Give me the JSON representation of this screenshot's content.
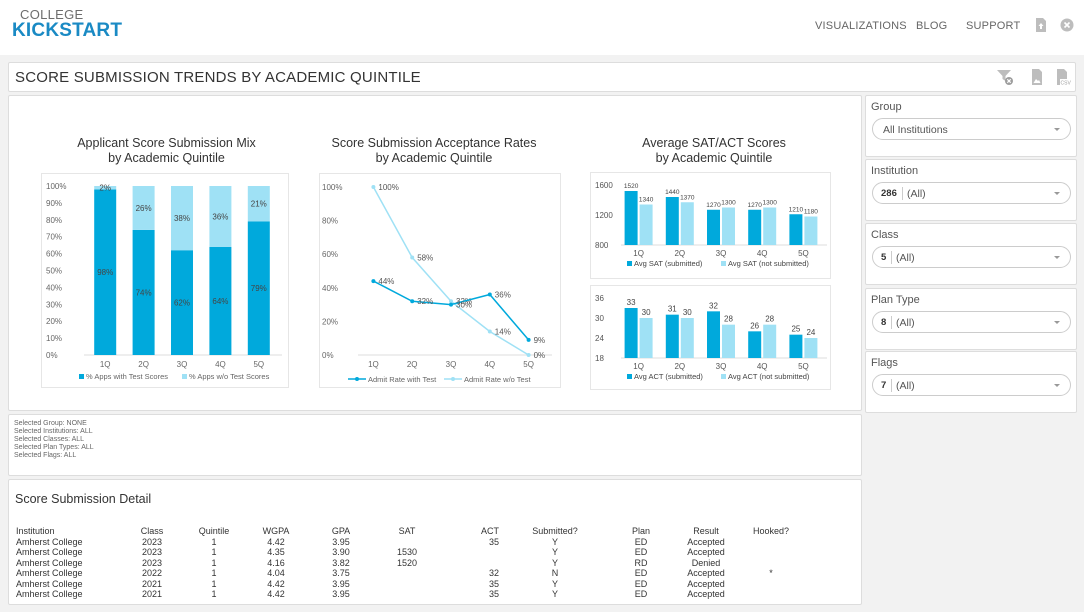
{
  "header": {
    "logo_top": "COLLEGE",
    "logo_bottom": "KICKSTART",
    "nav": [
      "VISUALIZATIONS",
      "BLOG",
      "SUPPORT"
    ],
    "icons": [
      "upload-file-icon",
      "close-circle-icon"
    ]
  },
  "page": {
    "title": "SCORE SUBMISSION TRENDS BY ACADEMIC QUINTILE",
    "toolbar_icons": [
      "clear-filter-icon",
      "image-export-icon",
      "csv-export-icon"
    ]
  },
  "colors": {
    "primary": "#00a9dc",
    "secondary": "#9fe1f5",
    "axis_text": "#666666"
  },
  "chart_data": [
    {
      "type": "bar",
      "stacked": true,
      "title": "Applicant Score Submission Mix\nby Academic Quintile",
      "title_lines": [
        "Applicant Score Submission Mix",
        "by Academic Quintile"
      ],
      "categories": [
        "1Q",
        "2Q",
        "3Q",
        "4Q",
        "5Q"
      ],
      "series": [
        {
          "name": "% Apps with Test Scores",
          "values": [
            98,
            74,
            62,
            64,
            79
          ]
        },
        {
          "name": "% Apps w/o Test Scores",
          "values": [
            2,
            26,
            38,
            36,
            21
          ]
        }
      ],
      "ylim": [
        0,
        100
      ],
      "yticks": [
        "0%",
        "10%",
        "20%",
        "30%",
        "40%",
        "50%",
        "60%",
        "70%",
        "80%",
        "90%",
        "100%"
      ],
      "legend": "bottom"
    },
    {
      "type": "line",
      "title": "Score Submission Acceptance Rates\nby Academic Quintile",
      "title_lines": [
        "Score Submission Acceptance Rates",
        "by Academic Quintile"
      ],
      "categories": [
        "1Q",
        "2Q",
        "3Q",
        "4Q",
        "5Q"
      ],
      "series": [
        {
          "name": "Admit Rate with Test",
          "values": [
            44,
            32,
            30,
            36,
            9
          ]
        },
        {
          "name": "Admit Rate w/o Test",
          "values": [
            100,
            58,
            32,
            14,
            0
          ]
        }
      ],
      "ylim": [
        0,
        100
      ],
      "yticks": [
        "0%",
        "20%",
        "40%",
        "60%",
        "80%",
        "100%"
      ],
      "legend": "bottom"
    },
    {
      "type": "bar",
      "title": "Average SAT/ACT Scores\nby Academic Quintile",
      "title_lines": [
        "Average SAT/ACT Scores",
        "by Academic Quintile"
      ],
      "categories": [
        "1Q",
        "2Q",
        "3Q",
        "4Q",
        "5Q"
      ],
      "series": [
        {
          "name": "Avg SAT (submitted)",
          "values": [
            1520,
            1440,
            1270,
            1270,
            1210
          ]
        },
        {
          "name": "Avg SAT (not submitted)",
          "values": [
            1340,
            1370,
            1300,
            1300,
            1180
          ]
        }
      ],
      "ylim": [
        800,
        1600
      ],
      "yticks": [
        "800",
        "1200",
        "1600"
      ],
      "legend": "bottom"
    },
    {
      "type": "bar",
      "categories": [
        "1Q",
        "2Q",
        "3Q",
        "4Q",
        "5Q"
      ],
      "series": [
        {
          "name": "Avg ACT (submitted)",
          "values": [
            33,
            31,
            32,
            26,
            25
          ]
        },
        {
          "name": "Avg ACT (not submitted)",
          "values": [
            30,
            30,
            28,
            28,
            24
          ]
        }
      ],
      "ylim": [
        18,
        36
      ],
      "yticks": [
        "18",
        "24",
        "30",
        "36"
      ],
      "legend": "bottom"
    }
  ],
  "filters": [
    {
      "label": "Group",
      "count": "",
      "value": "All Institutions"
    },
    {
      "label": "Institution",
      "count": "286",
      "value": "(All)"
    },
    {
      "label": "Class",
      "count": "5",
      "value": "(All)"
    },
    {
      "label": "Plan Type",
      "count": "8",
      "value": "(All)"
    },
    {
      "label": "Flags",
      "count": "7",
      "value": "(All)"
    }
  ],
  "selection_summary": [
    "Selected Group: NONE",
    "Selected Institutions: ALL",
    "Selected Classes: ALL",
    "Selected Plan Types: ALL",
    "Selected Flags: ALL"
  ],
  "detail": {
    "title": "Score Submission Detail",
    "columns": [
      "Institution",
      "Class",
      "Quintile",
      "WGPA",
      "GPA",
      "SAT",
      "ACT",
      "Submitted?",
      "Plan",
      "Result",
      "Hooked?"
    ],
    "rows": [
      [
        "Amherst College",
        "2023",
        "1",
        "4.42",
        "3.95",
        "",
        "35",
        "Y",
        "ED",
        "Accepted",
        ""
      ],
      [
        "Amherst College",
        "2023",
        "1",
        "4.35",
        "3.90",
        "1530",
        "",
        "Y",
        "ED",
        "Accepted",
        ""
      ],
      [
        "Amherst College",
        "2023",
        "1",
        "4.16",
        "3.82",
        "1520",
        "",
        "Y",
        "RD",
        "Denied",
        ""
      ],
      [
        "Amherst College",
        "2022",
        "1",
        "4.04",
        "3.75",
        "",
        "32",
        "N",
        "ED",
        "Accepted",
        "*"
      ],
      [
        "Amherst College",
        "2021",
        "1",
        "4.42",
        "3.95",
        "",
        "35",
        "Y",
        "ED",
        "Accepted",
        ""
      ],
      [
        "Amherst College",
        "2021",
        "1",
        "4.42",
        "3.95",
        "",
        "35",
        "Y",
        "ED",
        "Accepted",
        ""
      ]
    ]
  }
}
